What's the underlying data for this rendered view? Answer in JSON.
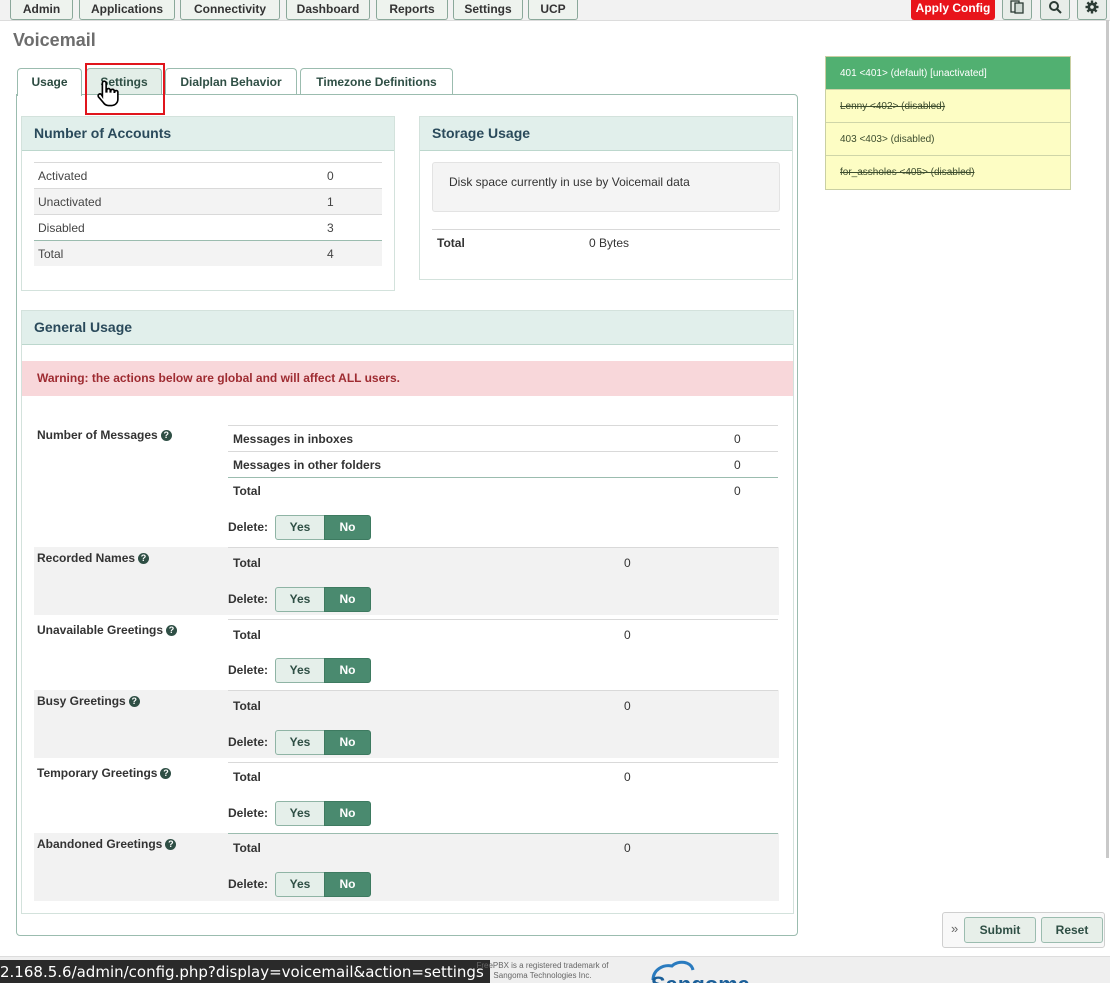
{
  "nav": {
    "items": [
      "Admin",
      "Applications",
      "Connectivity",
      "Dashboard",
      "Reports",
      "Settings",
      "UCP"
    ],
    "apply_config": "Apply Config",
    "icons": [
      "language-icon",
      "search-icon",
      "gear-icon"
    ]
  },
  "page_title": "Voicemail",
  "tabs": [
    "Usage",
    "Settings",
    "Dialplan Behavior",
    "Timezone Definitions"
  ],
  "accounts": {
    "title": "Number of Accounts",
    "rows": [
      {
        "label": "Activated",
        "value": "0"
      },
      {
        "label": "Unactivated",
        "value": "1"
      },
      {
        "label": "Disabled",
        "value": "3"
      },
      {
        "label": "Total",
        "value": "4"
      }
    ]
  },
  "storage": {
    "title": "Storage Usage",
    "desc": "Disk space currently in use by Voicemail data",
    "total_label": "Total",
    "total_value": "0 Bytes"
  },
  "general": {
    "title": "General Usage",
    "warning": "Warning: the actions below are global and will affect ALL users.",
    "messages": {
      "label": "Number of Messages",
      "rows": [
        {
          "label": "Messages in inboxes",
          "value": "0"
        },
        {
          "label": "Messages in other folders",
          "value": "0"
        },
        {
          "label": "Total",
          "value": "0"
        }
      ]
    },
    "sections": [
      {
        "label": "Recorded Names",
        "total_label": "Total",
        "value": "0"
      },
      {
        "label": "Unavailable Greetings",
        "total_label": "Total",
        "value": "0"
      },
      {
        "label": "Busy Greetings",
        "total_label": "Total",
        "value": "0"
      },
      {
        "label": "Temporary Greetings",
        "total_label": "Total",
        "value": "0"
      },
      {
        "label": "Abandoned Greetings",
        "total_label": "Total",
        "value": "0"
      }
    ],
    "delete_label": "Delete:",
    "yes": "Yes",
    "no": "No"
  },
  "extensions": [
    {
      "label": "401 <401>  (default) [unactivated]",
      "state": "active"
    },
    {
      "label": "Lenny <402>  (disabled)",
      "state": "disabled"
    },
    {
      "label": "403 <403>  (disabled)",
      "state": "normal"
    },
    {
      "label": "for_assholes <405>  (disabled)",
      "state": "disabled"
    }
  ],
  "buttons": {
    "submit": "Submit",
    "reset": "Reset",
    "toggle": "»"
  },
  "footer": {
    "url": "2.168.5.6/admin/config.php?display=voicemail&action=settings",
    "trademark_line1": "FreePBX is a registered trademark of",
    "trademark_line2": "Sangoma Technologies Inc.",
    "logo": "Sangoma"
  },
  "colors": {
    "accent": "#4a8a6f",
    "apply": "#e8141b",
    "warning_bg": "#f8d7da",
    "ext_active": "#51b071",
    "ext_bg": "#fdfdc4"
  }
}
